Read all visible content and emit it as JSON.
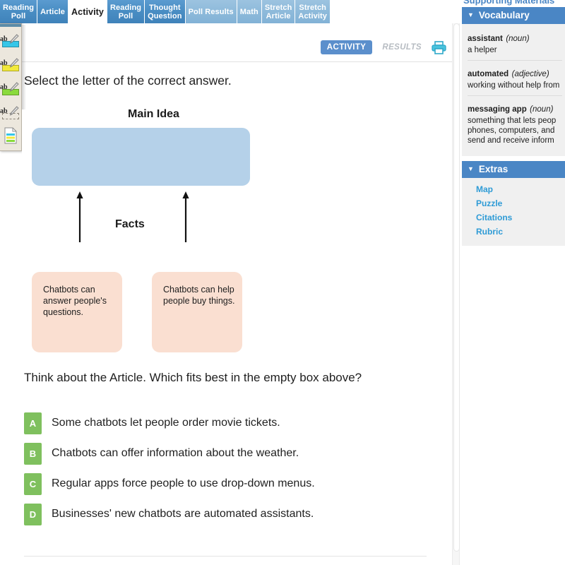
{
  "tabs": [
    {
      "label": "Reading\nPoll",
      "state": "normal"
    },
    {
      "label": "Article",
      "state": "normal"
    },
    {
      "label": "Activity",
      "state": "active"
    },
    {
      "label": "Reading\nPoll",
      "state": "normal"
    },
    {
      "label": "Thought\nQuestion",
      "state": "normal"
    },
    {
      "label": "Poll Results",
      "state": "faded"
    },
    {
      "label": "Math",
      "state": "faded"
    },
    {
      "label": "Stretch\nArticle",
      "state": "faded"
    },
    {
      "label": "Stretch\nActivity",
      "state": "faded"
    }
  ],
  "palette": {
    "items": [
      {
        "name": "highlighter-cyan",
        "color": "#35c6e8",
        "glyph": "ab"
      },
      {
        "name": "highlighter-yellow",
        "color": "#f2e93b",
        "glyph": "ab"
      },
      {
        "name": "highlighter-green",
        "color": "#8ada3c",
        "glyph": "ab"
      },
      {
        "name": "highlighter-eraser",
        "color": "",
        "glyph": "ab"
      }
    ],
    "doc_label": "notes-document"
  },
  "toolbar": {
    "activity_label": "ACTIVITY",
    "results_label": "RESULTS",
    "print_label": "printer",
    "accent": "#5b8fcc"
  },
  "activity": {
    "prompt": "Select the letter of the correct answer.",
    "question": "Think about the Article. Which fits best in the empty box above?"
  },
  "diagram": {
    "main_idea_title": "Main Idea",
    "main_idea_text": "",
    "main_idea_color": "#b5d1e9",
    "facts_title": "Facts",
    "fact_color": "#fadfd1",
    "facts": [
      "Chatbots can answer people's questions.",
      "Chatbots can help people buy things."
    ]
  },
  "options": [
    {
      "letter": "A",
      "text": "Some chatbots let people order movie tickets."
    },
    {
      "letter": "B",
      "text": "Chatbots can offer information about the weather."
    },
    {
      "letter": "C",
      "text": "Regular apps force people to use drop-down menus."
    },
    {
      "letter": "D",
      "text": "Businesses' new chatbots are automated assistants."
    }
  ],
  "sidebar": {
    "supporting_title": "Supporting Materials",
    "vocabulary": {
      "header": "Vocabulary",
      "items": [
        {
          "word": "assistant",
          "pos": "(noun)",
          "definition": "a helper"
        },
        {
          "word": "automated",
          "pos": "(adjective)",
          "definition": "working without help from"
        },
        {
          "word": "messaging app",
          "pos": "(noun)",
          "definition": "something that lets peop phones, computers, and send and receive inform"
        }
      ]
    },
    "extras": {
      "header": "Extras",
      "links": [
        "Map",
        "Puzzle",
        "Citations",
        "Rubric"
      ]
    }
  }
}
